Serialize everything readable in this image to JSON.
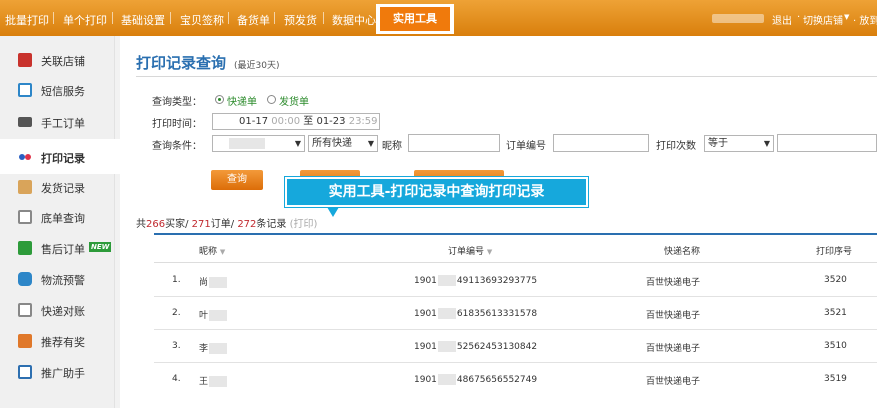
{
  "topnav": {
    "items": [
      "批量打印",
      "单个打印",
      "基础设置",
      "宝贝签称",
      "备货单",
      "预发货",
      "数据中心"
    ],
    "active": "实用工具",
    "logout": "退出",
    "switch_shop": "切换店铺",
    "truncated": "· 放到"
  },
  "sidebar": {
    "items": [
      {
        "label": "关联店铺",
        "icon": "dice-icon",
        "color": "#c8322c"
      },
      {
        "label": "短信服务",
        "icon": "sms-icon",
        "color": "#2d86c8"
      },
      {
        "label": "手工订单",
        "icon": "printer-icon",
        "color": "#555555"
      },
      {
        "label": "打印记录",
        "icon": "record-icon",
        "color": "#2b5fc2"
      },
      {
        "label": "发货记录",
        "icon": "shipment-icon",
        "color": "#c88a2c"
      },
      {
        "label": "底单查询",
        "icon": "document-icon",
        "color": "#777777"
      },
      {
        "label": "售后订单",
        "icon": "after-sale-icon",
        "color": "#2d9b3a"
      },
      {
        "label": "物流预警",
        "icon": "warning-icon",
        "color": "#2d86c8"
      },
      {
        "label": "快递对账",
        "icon": "reconcile-icon",
        "color": "#777777"
      },
      {
        "label": "推荐有奖",
        "icon": "gift-icon",
        "color": "#e0782a"
      },
      {
        "label": "推广助手",
        "icon": "promo-icon",
        "color": "#2d6fb0"
      }
    ],
    "active_index": 3,
    "new_badge": "NEW"
  },
  "main": {
    "title": "打印记录查询",
    "subtitle": "(最近30天)",
    "query_type_label": "查询类型：",
    "query_type_options": [
      "快递单",
      "发货单"
    ],
    "print_time_label": "打印时间：",
    "date_from": "01-17",
    "time_from": "00:00",
    "date_to_sep": "至",
    "date_to": "01-23",
    "time_to": "23:59",
    "condition_label": "查询条件：",
    "express_select": "所有快递",
    "nickname_label": "昵称",
    "order_no_label": "订单编号",
    "print_count_label": "打印次数",
    "compare_select": "等于",
    "query_button": "查询",
    "summary": {
      "prefix": "共",
      "buyers": "266",
      "buyers_unit": "买家/ ",
      "orders": "271",
      "orders_unit": "订单/ ",
      "records": "272",
      "records_unit": "条记录 ",
      "note": "(打印)"
    },
    "callout": "实用工具-打印记录中查询打印记录",
    "table": {
      "columns": [
        "昵称",
        "订单编号",
        "快递名称",
        "打印序号"
      ],
      "rows": [
        {
          "index": "1.",
          "nick": "尚",
          "order_prefix": "1901",
          "order_suffix": "49113693293775",
          "express": "百世快递电子",
          "seq": "3520"
        },
        {
          "index": "2.",
          "nick": "叶",
          "order_prefix": "1901",
          "order_suffix": "61835613331578",
          "express": "百世快递电子",
          "seq": "3521"
        },
        {
          "index": "3.",
          "nick": "李",
          "order_prefix": "1901",
          "order_suffix": "52562453130842",
          "express": "百世快递电子",
          "seq": "3510"
        },
        {
          "index": "4.",
          "nick": "王",
          "order_prefix": "1901",
          "order_suffix": "48675656552749",
          "express": "百世快递电子",
          "seq": "3519"
        }
      ]
    }
  }
}
